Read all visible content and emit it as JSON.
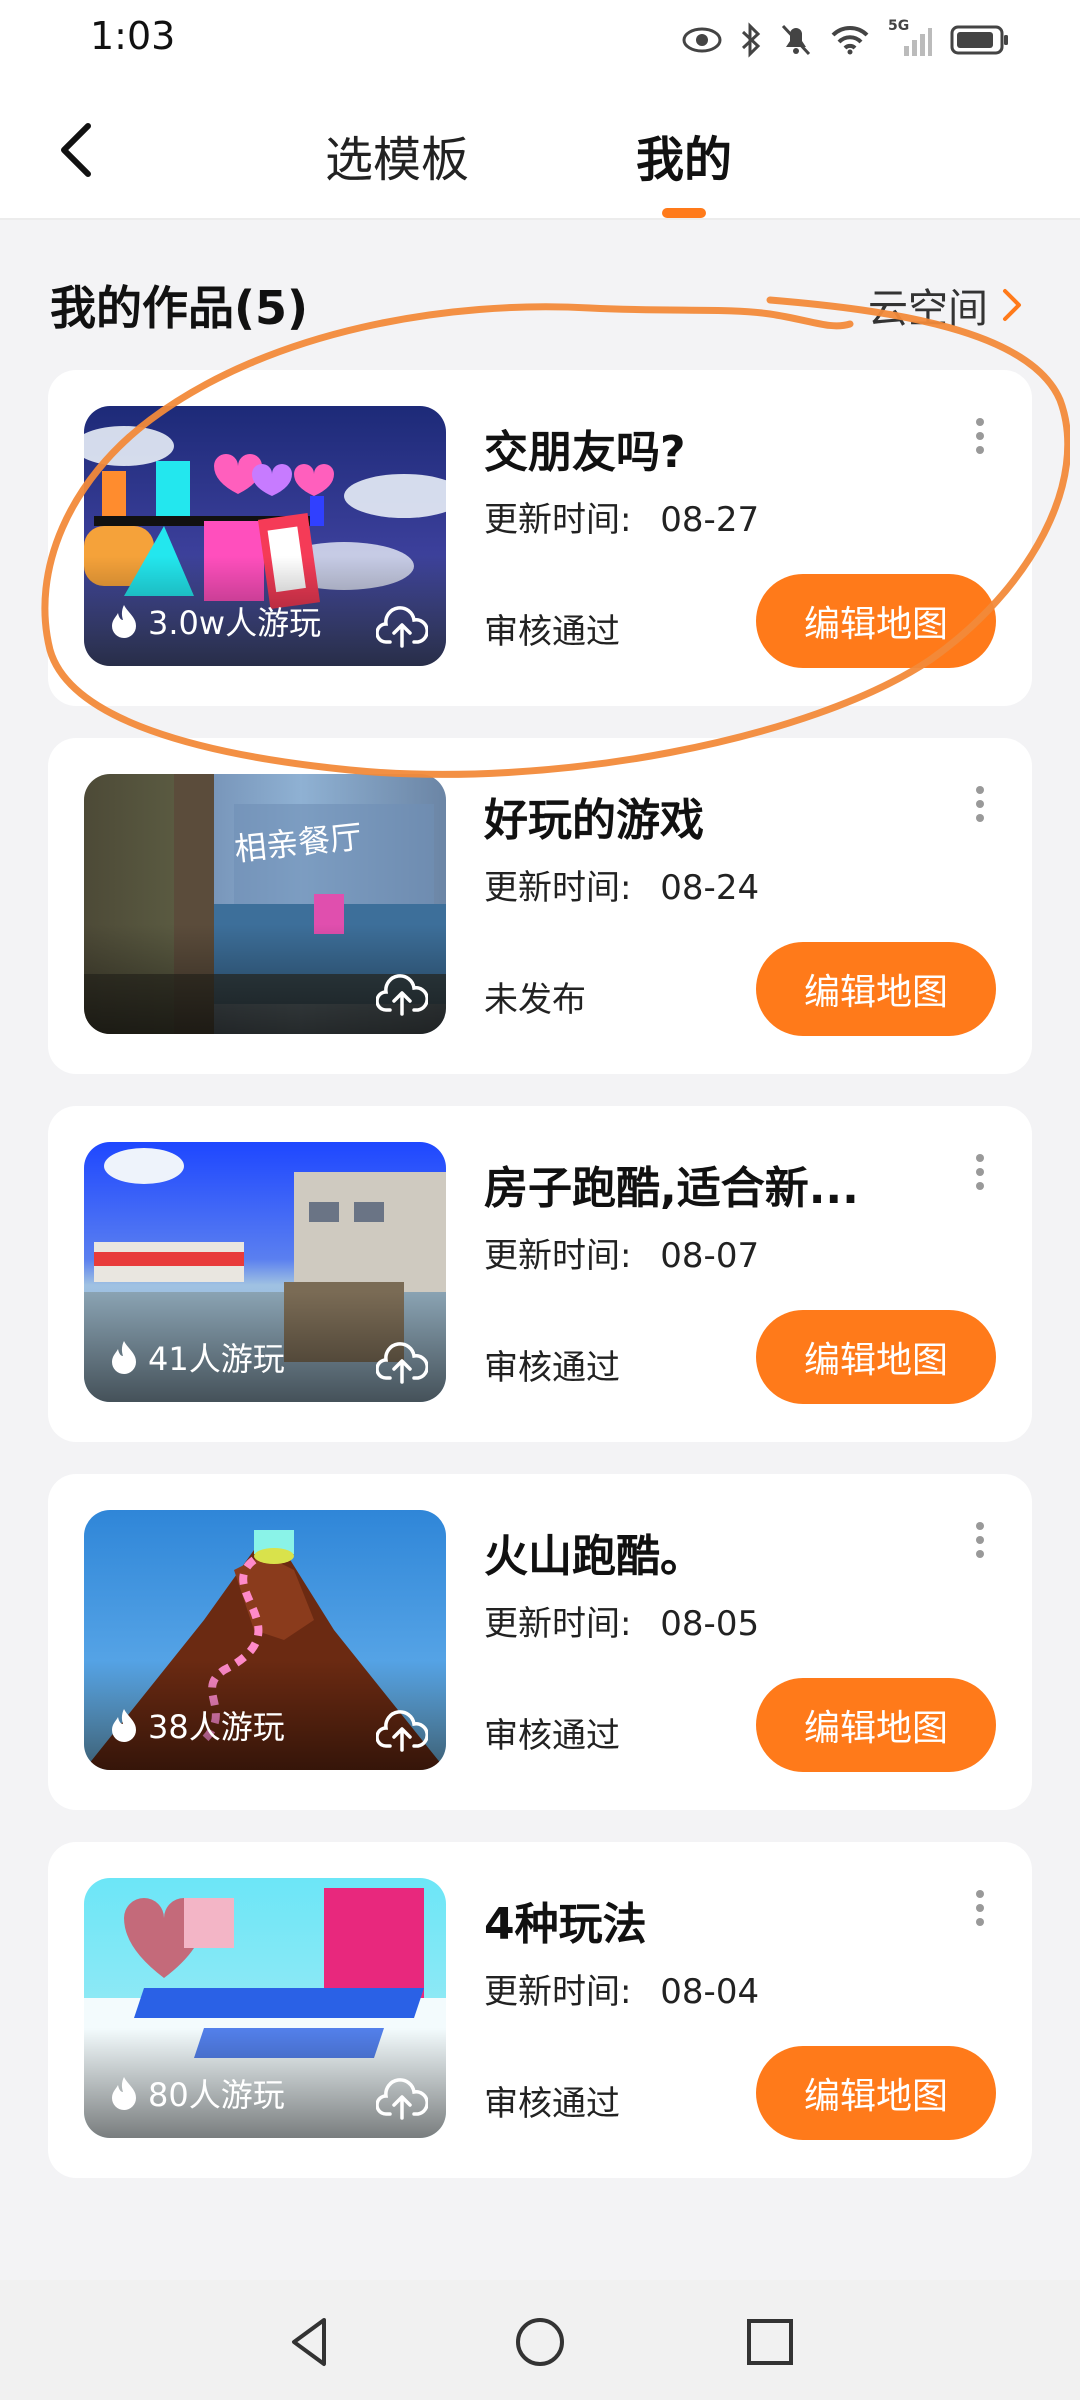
{
  "status_bar": {
    "time": "1:03",
    "network": "5G",
    "icons": [
      "eye-icon",
      "bluetooth-icon",
      "mute-bell-icon",
      "wifi-icon",
      "signal-icon",
      "battery-icon"
    ]
  },
  "nav": {
    "tabs": [
      {
        "label": "选模板",
        "active": false
      },
      {
        "label": "我的",
        "active": true
      }
    ],
    "accent": "#ff7a1a"
  },
  "section": {
    "title": "我的作品(5)",
    "cloud_link": "云空间"
  },
  "cards": [
    {
      "title": "交朋友吗?",
      "updated_label": "更新时间:",
      "updated": "08-27",
      "status": "审核通过",
      "plays": "3.0w人游玩",
      "edit_label": "编辑地图"
    },
    {
      "title": "好玩的游戏",
      "updated_label": "更新时间:",
      "updated": "08-24",
      "status": "未发布",
      "plays": "",
      "edit_label": "编辑地图",
      "thumb_text": "相亲餐厅"
    },
    {
      "title": "房子跑酷,适合新...",
      "updated_label": "更新时间:",
      "updated": "08-07",
      "status": "审核通过",
      "plays": "41人游玩",
      "edit_label": "编辑地图"
    },
    {
      "title": "火山跑酷。",
      "updated_label": "更新时间:",
      "updated": "08-05",
      "status": "审核通过",
      "plays": "38人游玩",
      "edit_label": "编辑地图"
    },
    {
      "title": "4种玩法",
      "updated_label": "更新时间:",
      "updated": "08-04",
      "status": "审核通过",
      "plays": "80人游玩",
      "edit_label": "编辑地图"
    }
  ]
}
